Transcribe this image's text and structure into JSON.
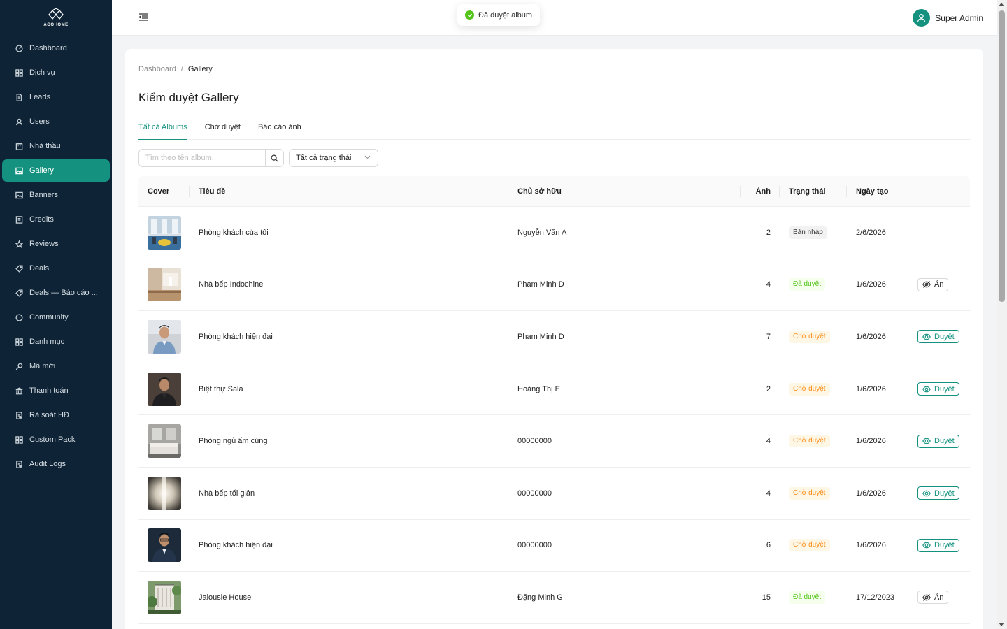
{
  "brand": {
    "name": "AGOHOME",
    "accent": "#14927f",
    "sidebar_bg": "#0e2436"
  },
  "sidebar": {
    "items": [
      {
        "label": "Dashboard",
        "icon": "dashboard-icon"
      },
      {
        "label": "Dịch vụ",
        "icon": "grid-icon"
      },
      {
        "label": "Leads",
        "icon": "file-icon"
      },
      {
        "label": "Users",
        "icon": "user-icon"
      },
      {
        "label": "Nhà thầu",
        "icon": "building-icon"
      },
      {
        "label": "Gallery",
        "icon": "image-icon",
        "active": true
      },
      {
        "label": "Banners",
        "icon": "image-icon"
      },
      {
        "label": "Credits",
        "icon": "wallet-icon"
      },
      {
        "label": "Reviews",
        "icon": "star-icon"
      },
      {
        "label": "Deals",
        "icon": "tag-icon"
      },
      {
        "label": "Deals — Báo cáo ...",
        "icon": "tag-icon"
      },
      {
        "label": "Community",
        "icon": "chat-icon"
      },
      {
        "label": "Danh mục",
        "icon": "grid-icon"
      },
      {
        "label": "Mã mời",
        "icon": "key-icon"
      },
      {
        "label": "Thanh toán",
        "icon": "bank-icon"
      },
      {
        "label": "Rà soát HĐ",
        "icon": "audit-icon"
      },
      {
        "label": "Custom Pack",
        "icon": "grid-icon"
      },
      {
        "label": "Audit Logs",
        "icon": "audit-icon"
      }
    ]
  },
  "header": {
    "user_name": "Super Admin"
  },
  "toast": {
    "message": "Đã duyệt album"
  },
  "breadcrumb": {
    "root": "Dashboard",
    "separator": "/",
    "current": "Gallery"
  },
  "page": {
    "title": "Kiểm duyệt Gallery"
  },
  "tabs": [
    {
      "label": "Tất cả Albums",
      "active": true
    },
    {
      "label": "Chờ duyệt"
    },
    {
      "label": "Báo cáo ảnh"
    }
  ],
  "filters": {
    "search_placeholder": "Tìm theo tên album...",
    "status_selected": "Tất cả trạng thái"
  },
  "table": {
    "columns": {
      "cover": "Cover",
      "title": "Tiêu đề",
      "owner": "Chủ sở hữu",
      "photos": "Ảnh",
      "status": "Trạng thái",
      "created": "Ngày tạo"
    },
    "rows": [
      {
        "title": "Phòng khách của tôi",
        "owner": "Nguyễn Văn A",
        "photos": "2",
        "status": "Bản nháp",
        "status_kind": "draft",
        "created": "2/6/2026",
        "action": "",
        "cover": "living-blue"
      },
      {
        "title": "Nhà bếp Indochine",
        "owner": "Phạm Minh D",
        "photos": "4",
        "status": "Đã duyệt",
        "status_kind": "approved",
        "created": "1/6/2026",
        "action": "Ẩn",
        "action_kind": "hide",
        "cover": "kitchen-beige"
      },
      {
        "title": "Phòng khách hiện đại",
        "owner": "Phạm Minh D",
        "photos": "7",
        "status": "Chờ duyệt",
        "status_kind": "pending",
        "created": "1/6/2026",
        "action": "Duyệt",
        "action_kind": "approve",
        "cover": "portrait-light"
      },
      {
        "title": "Biệt thự Sala",
        "owner": "Hoàng Thị E",
        "photos": "2",
        "status": "Chờ duyệt",
        "status_kind": "pending",
        "created": "1/6/2026",
        "action": "Duyệt",
        "action_kind": "approve",
        "cover": "portrait-dark"
      },
      {
        "title": "Phòng ngủ ấm cúng",
        "owner": "00000000",
        "photos": "4",
        "status": "Chờ duyệt",
        "status_kind": "pending",
        "created": "1/6/2026",
        "action": "Duyệt",
        "action_kind": "approve",
        "cover": "bedroom-grey"
      },
      {
        "title": "Nhà bếp tối giản",
        "owner": "00000000",
        "photos": "4",
        "status": "Chờ duyệt",
        "status_kind": "pending",
        "created": "1/6/2026",
        "action": "Duyệt",
        "action_kind": "approve",
        "cover": "light-glow"
      },
      {
        "title": "Phòng khách hiện đại",
        "owner": "00000000",
        "photos": "6",
        "status": "Chờ duyệt",
        "status_kind": "pending",
        "created": "1/6/2026",
        "action": "Duyệt",
        "action_kind": "approve",
        "cover": "portrait-navy"
      },
      {
        "title": "Jalousie House",
        "owner": "Đặng Minh G",
        "photos": "15",
        "status": "Đã duyệt",
        "status_kind": "approved",
        "created": "17/12/2023",
        "action": "Ẩn",
        "action_kind": "hide",
        "cover": "house-green"
      }
    ]
  }
}
